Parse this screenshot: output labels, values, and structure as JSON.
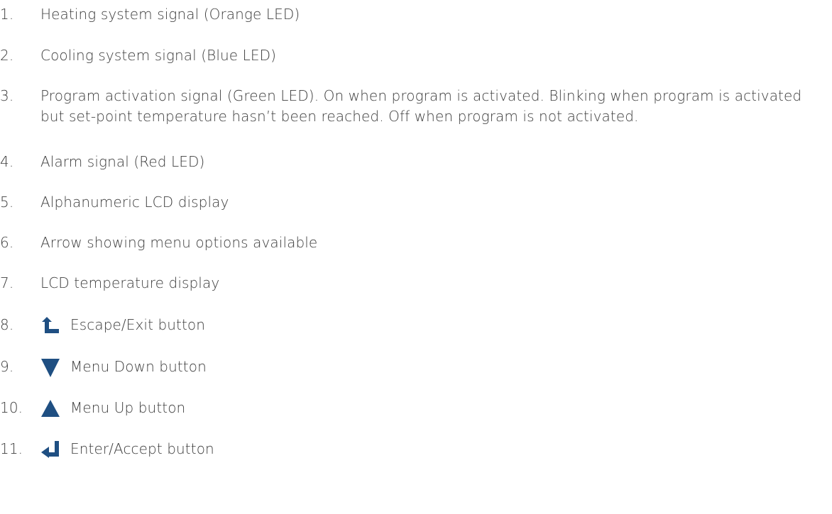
{
  "items": [
    {
      "num": "1.",
      "text": "Heating system signal (Orange LED)"
    },
    {
      "num": "2.",
      "text": "Cooling system signal (Blue LED)"
    },
    {
      "num": "3.",
      "text": "Program activation signal (Green LED). On when program is activated. Blinking when program is activated but set-point temperature hasn’t been reached. Off when program is not activated."
    },
    {
      "num": "4.",
      "text": "Alarm signal (Red LED)"
    },
    {
      "num": "5.",
      "text": "Alphanumeric LCD display"
    },
    {
      "num": "6.",
      "text": "Arrow showing menu options available"
    },
    {
      "num": "7.",
      "text": "LCD temperature display"
    },
    {
      "num": "8.",
      "text": "Escape/Exit button",
      "icon": "escape-arrow-icon"
    },
    {
      "num": "9.",
      "text": "Menu Down button",
      "icon": "down-triangle-icon"
    },
    {
      "num": "10.",
      "text": "Menu Up button",
      "icon": "up-triangle-icon"
    },
    {
      "num": "11.",
      "text": "Enter/Accept button",
      "icon": "enter-arrow-icon"
    }
  ],
  "colors": {
    "text": "#3d3d3d",
    "icon": "#1f4f82"
  }
}
